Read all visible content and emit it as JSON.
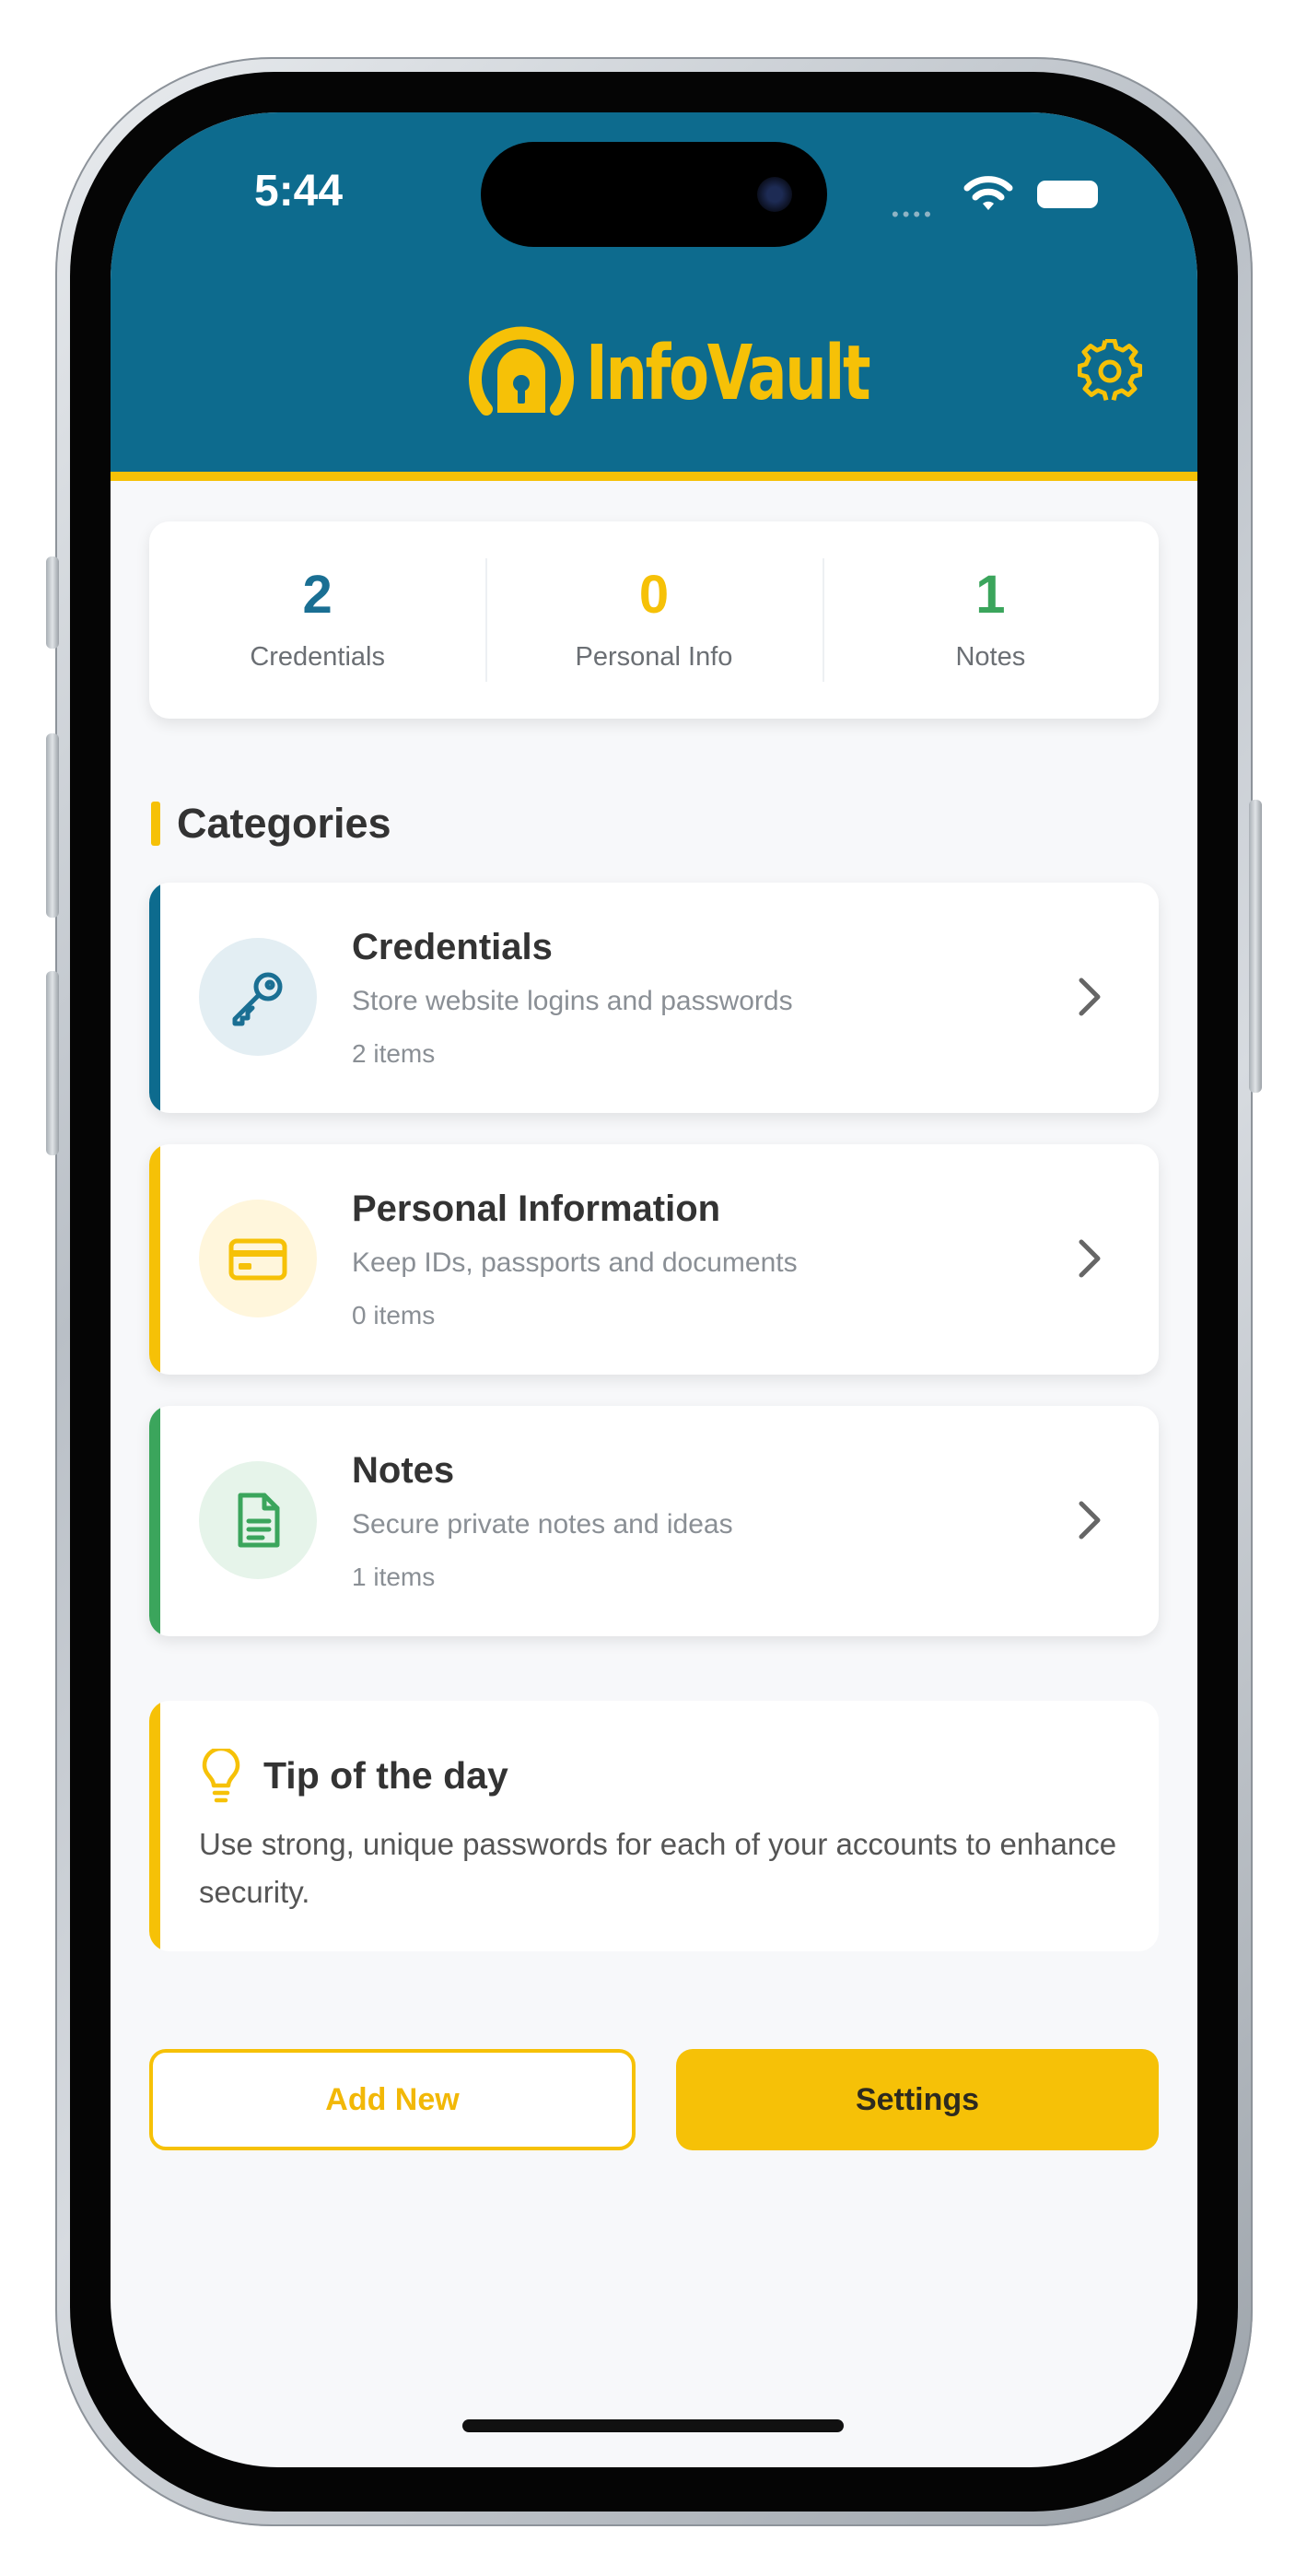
{
  "status_bar": {
    "time": "5:44"
  },
  "app": {
    "name": "InfoVault",
    "colors": {
      "primary": "#0d6b8e",
      "accent": "#f6c107",
      "success": "#3ba55c",
      "background": "#f7f8fa"
    }
  },
  "stats": [
    {
      "value": "2",
      "label": "Credentials",
      "color": "#1a6f93"
    },
    {
      "value": "0",
      "label": "Personal Info",
      "color": "#f6c107"
    },
    {
      "value": "1",
      "label": "Notes",
      "color": "#3ba55c"
    }
  ],
  "categories": {
    "title": "Categories",
    "items": [
      {
        "title": "Credentials",
        "description": "Store website logins and passwords",
        "count": "2 items",
        "icon": "key-icon",
        "accent": "#0d6b8e"
      },
      {
        "title": "Personal Information",
        "description": "Keep IDs, passports and documents",
        "count": "0 items",
        "icon": "id-card-icon",
        "accent": "#f6c107"
      },
      {
        "title": "Notes",
        "description": "Secure private notes and ideas",
        "count": "1 items",
        "icon": "document-icon",
        "accent": "#3ba55c"
      }
    ]
  },
  "tip": {
    "title": "Tip of the day",
    "text": "Use strong, unique passwords for each of your accounts to enhance security."
  },
  "buttons": {
    "add_new": "Add New",
    "settings": "Settings"
  }
}
